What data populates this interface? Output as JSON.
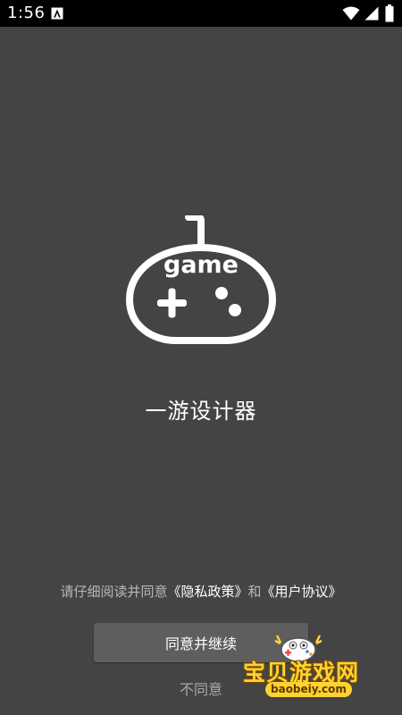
{
  "status_bar": {
    "time": "1:56",
    "notification_icon": "a-box-icon",
    "wifi_icon": "wifi-icon",
    "signal_icon": "signal-icon",
    "battery_icon": "battery-icon"
  },
  "splash": {
    "logo_text": "game",
    "app_name": "一游设计器"
  },
  "agreement": {
    "prefix": "请仔细阅读并同意",
    "privacy_link": "《隐私政策》",
    "conjunction": "和",
    "terms_link": "《用户协议》"
  },
  "actions": {
    "agree_label": "同意并继续",
    "disagree_label": "不同意"
  },
  "watermark": {
    "title": "宝贝游戏网",
    "url": "baobeiy.com"
  },
  "colors": {
    "background": "#444444",
    "button": "#5e5e5e",
    "watermark": "#ffd230"
  }
}
